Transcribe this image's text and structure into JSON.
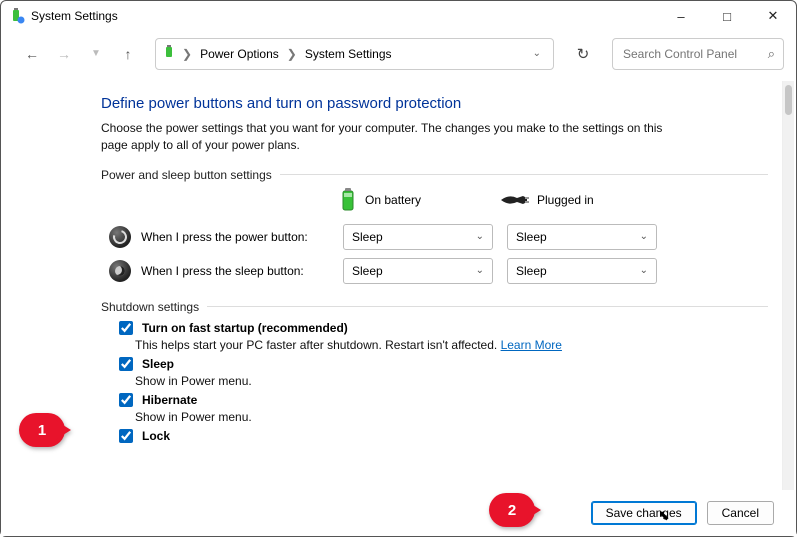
{
  "window": {
    "title": "System Settings"
  },
  "breadcrumb": {
    "root": "Power Options",
    "leaf": "System Settings"
  },
  "search": {
    "placeholder": "Search Control Panel"
  },
  "heading": "Define power buttons and turn on password protection",
  "description": "Choose the power settings that you want for your computer. The changes you make to the settings on this page apply to all of your power plans.",
  "group_power": {
    "label": "Power and sleep button settings",
    "col_battery": "On battery",
    "col_plugged": "Plugged in",
    "row_power": {
      "label": "When I press the power button:",
      "battery": "Sleep",
      "plugged": "Sleep"
    },
    "row_sleep": {
      "label": "When I press the sleep button:",
      "battery": "Sleep",
      "plugged": "Sleep"
    }
  },
  "group_shutdown": {
    "label": "Shutdown settings",
    "fast": {
      "title": "Turn on fast startup (recommended)",
      "sub_a": "This helps start your PC faster after shutdown. Restart isn't affected. ",
      "link": "Learn More"
    },
    "sleep": {
      "title": "Sleep",
      "sub": "Show in Power menu."
    },
    "hibernate": {
      "title": "Hibernate",
      "sub": "Show in Power menu."
    },
    "lock": {
      "title": "Lock"
    }
  },
  "footer": {
    "save": "Save changes",
    "cancel": "Cancel"
  },
  "annotations": {
    "one": "1",
    "two": "2"
  }
}
